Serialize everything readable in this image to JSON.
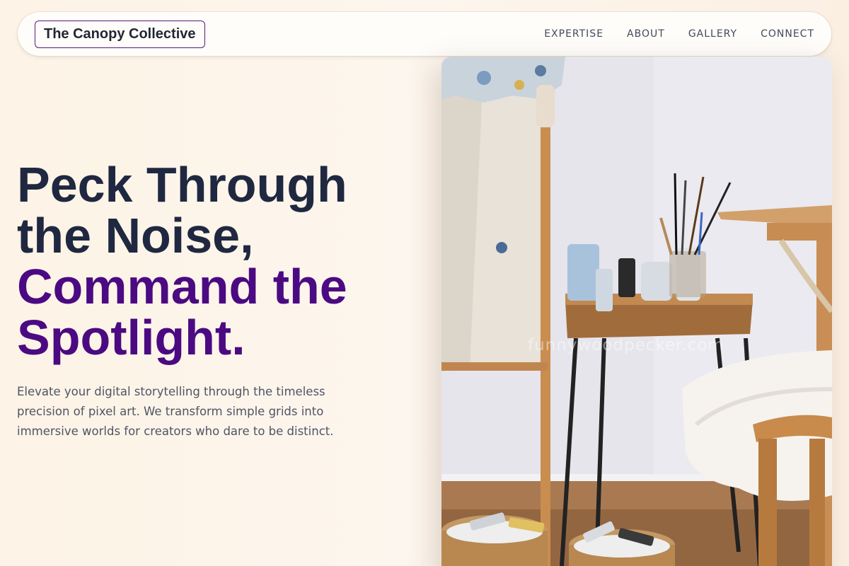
{
  "brand": {
    "name": "The Canopy Collective",
    "border_color": "#5a1a7a"
  },
  "nav": {
    "links": [
      "EXPERTISE",
      "ABOUT",
      "GALLERY",
      "CONNECT"
    ]
  },
  "hero": {
    "title_line1": "Peck Through",
    "title_line2": "the Noise,",
    "title_line3": "Command the",
    "title_line4": "Spotlight.",
    "title_color": "#1f2840",
    "accent_color": "#4b0a82",
    "subtitle": "Elevate your digital storytelling through the timeless precision of pixel art. We transform simple grids into immersive worlds for creators who dare to be distinct."
  },
  "image": {
    "subject": "artist studio with easel, paint brushes on small stool, and paint tubes in baskets",
    "watermark": "funnywoodpecker.com"
  }
}
